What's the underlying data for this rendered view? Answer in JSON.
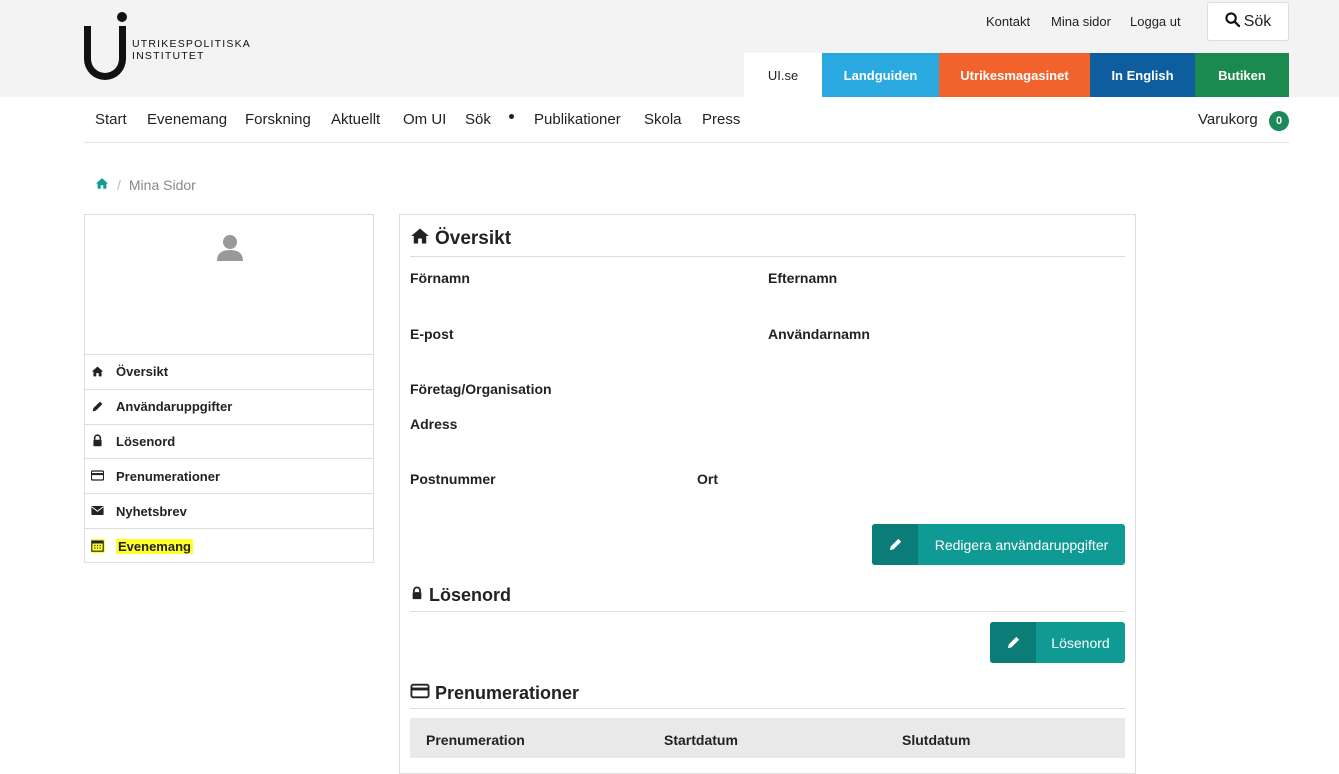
{
  "logo": {
    "line1": "UTRIKESPOLITISKA",
    "line2": "INSTITUTET"
  },
  "top_links": {
    "contact": "Kontakt",
    "my_pages": "Mina sidor",
    "logout": "Logga ut"
  },
  "search_button": "Sök",
  "site_tabs": [
    {
      "label": "UI.se",
      "bg": "#ffffff",
      "fg": "#222222"
    },
    {
      "label": "Landguiden",
      "bg": "#29a9df"
    },
    {
      "label": "Utrikesmagasinet",
      "bg": "#f2622c"
    },
    {
      "label": "In English",
      "bg": "#0d5d9f"
    },
    {
      "label": "Butiken",
      "bg": "#1b8a4f"
    }
  ],
  "main_nav": [
    "Start",
    "Evenemang",
    "Forskning",
    "Aktuellt",
    "Om UI",
    "Sök",
    "Publikationer",
    "Skola",
    "Press"
  ],
  "cart": {
    "label": "Varukorg",
    "count": "0"
  },
  "breadcrumb": {
    "current": "Mina Sidor"
  },
  "sidebar": {
    "items": [
      {
        "label": "Översikt",
        "icon": "home-icon"
      },
      {
        "label": "Användaruppgifter",
        "icon": "pencil-icon"
      },
      {
        "label": "Lösenord",
        "icon": "lock-icon"
      },
      {
        "label": "Prenumerationer",
        "icon": "credit-card-icon"
      },
      {
        "label": "Nyhetsbrev",
        "icon": "envelope-icon"
      },
      {
        "label": "Evenemang",
        "icon": "calendar-icon",
        "highlighted": true
      }
    ]
  },
  "overview": {
    "title": "Översikt",
    "fields": {
      "first_name": "Förnamn",
      "last_name": "Efternamn",
      "email": "E-post",
      "username": "Användarnamn",
      "company": "Företag/Organisation",
      "address": "Adress",
      "postal_code": "Postnummer",
      "city": "Ort"
    },
    "edit_button": "Redigera användaruppgifter"
  },
  "password": {
    "title": "Lösenord",
    "button": "Lösenord"
  },
  "subscriptions": {
    "title": "Prenumerationer",
    "columns": [
      "Prenumeration",
      "Startdatum",
      "Slutdatum"
    ]
  },
  "colors": {
    "teal": "#0f9a94",
    "teal_dark": "#0b7c77",
    "highlight": "#ffff2a",
    "green_badge": "#1b8a5a"
  }
}
